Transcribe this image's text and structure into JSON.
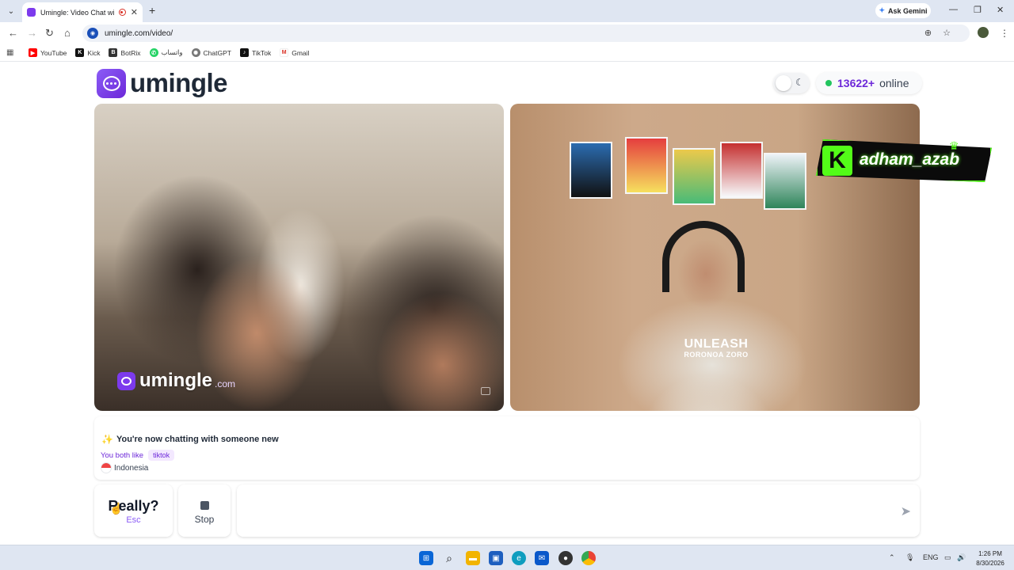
{
  "browser": {
    "tab_title": "Umingle: Video Chat with S",
    "new_tab": "+",
    "ask_gemini": "Ask Gemini",
    "url": "umingle.com/video/",
    "bookmarks": [
      {
        "label": "YouTube",
        "icon": "youtube-icon",
        "color": "#ff0000"
      },
      {
        "label": "Kick",
        "icon": "kick-icon",
        "color": "#111111"
      },
      {
        "label": "BotRix",
        "icon": "botrix-icon",
        "color": "#333333"
      },
      {
        "label": "واتساب",
        "icon": "whatsapp-icon",
        "color": "#25d366"
      },
      {
        "label": "ChatGPT",
        "icon": "chatgpt-icon",
        "color": "#555555"
      },
      {
        "label": "TikTok",
        "icon": "tiktok-icon",
        "color": "#111111"
      },
      {
        "label": "Gmail",
        "icon": "gmail-icon",
        "color": "#d93025"
      }
    ]
  },
  "header": {
    "logo_text": "umingle",
    "online_count": "13622+",
    "online_label": "online",
    "online_dot_color": "#22c55e"
  },
  "remote_video": {
    "watermark_name": "umingle",
    "watermark_tld": ".com"
  },
  "self_video": {
    "shirt_line1": "UNLEASH",
    "shirt_line2": "RORONOA ZORO",
    "overlay_handle": "adham_azab",
    "overlay_logo": "K"
  },
  "chat_info": {
    "status": "You're now chatting with someone new",
    "common_label": "You both like",
    "common_tag": "tiktok",
    "country": "Indonesia"
  },
  "controls": {
    "esc_main": "Really?",
    "esc_sub": "Esc",
    "stop_label": "Stop",
    "message_placeholder": ""
  },
  "taskbar": {
    "lang": "ENG",
    "time": "1:26 PM",
    "date": "8/30/2026"
  },
  "colors": {
    "brand": "#7c3aed",
    "accent_text": "#6d28d9"
  }
}
